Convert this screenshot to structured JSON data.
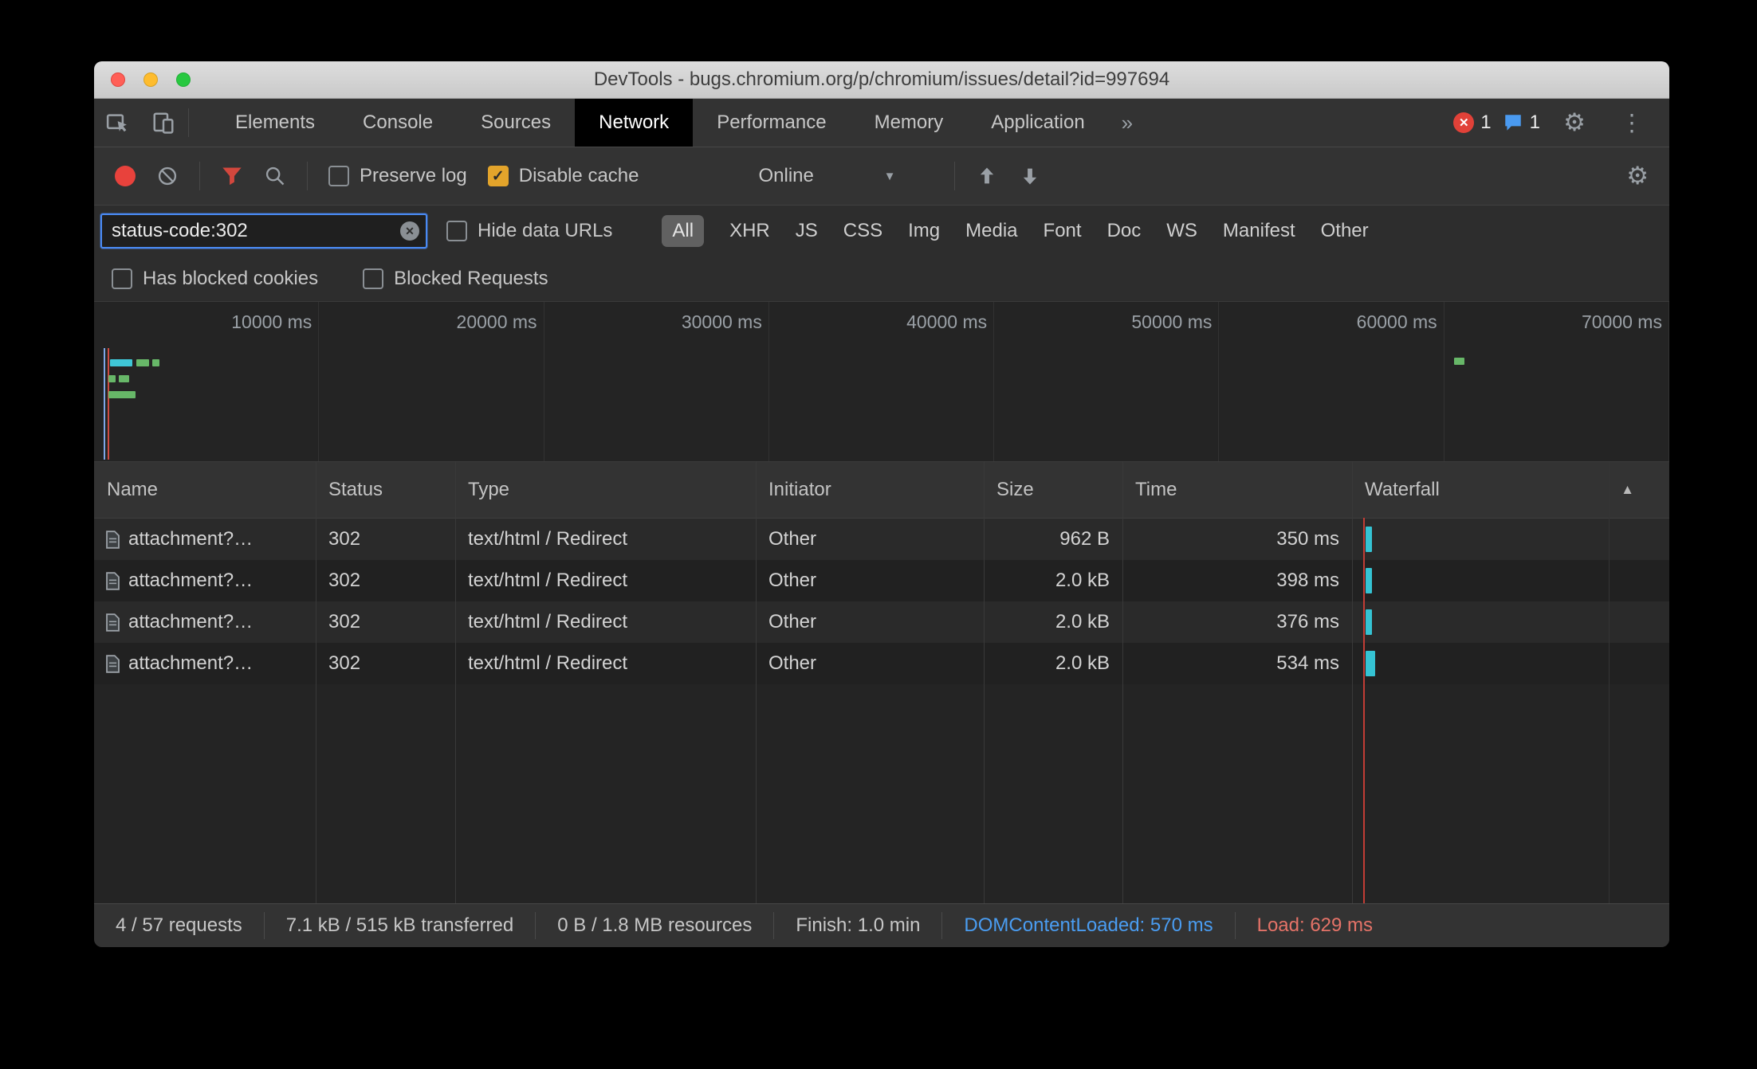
{
  "window": {
    "title": "DevTools - bugs.chromium.org/p/chromium/issues/detail?id=997694"
  },
  "main_tabs": {
    "items": [
      "Elements",
      "Console",
      "Sources",
      "Network",
      "Performance",
      "Memory",
      "Application"
    ],
    "selected": "Network"
  },
  "badges": {
    "error_count": "1",
    "message_count": "1"
  },
  "network_toolbar": {
    "preserve_log": "Preserve log",
    "disable_cache": "Disable cache",
    "disable_cache_checked": true,
    "preserve_log_checked": false,
    "throttling": "Online"
  },
  "filter_bar": {
    "filter_value": "status-code:302",
    "hide_data_urls": "Hide data URLs",
    "hide_data_urls_checked": false,
    "types": [
      "All",
      "XHR",
      "JS",
      "CSS",
      "Img",
      "Media",
      "Font",
      "Doc",
      "WS",
      "Manifest",
      "Other"
    ],
    "selected_type": "All"
  },
  "filter_row2": {
    "has_blocked_cookies": "Has blocked cookies",
    "blocked_requests": "Blocked Requests"
  },
  "timeline": {
    "labels": [
      "10000 ms",
      "20000 ms",
      "30000 ms",
      "40000 ms",
      "50000 ms",
      "60000 ms",
      "70000 ms"
    ]
  },
  "table": {
    "columns": [
      "Name",
      "Status",
      "Type",
      "Initiator",
      "Size",
      "Time",
      "Waterfall"
    ],
    "rows": [
      {
        "name": "attachment?…",
        "status": "302",
        "type": "text/html / Redirect",
        "initiator": "Other",
        "size": "962 B",
        "time": "350 ms"
      },
      {
        "name": "attachment?…",
        "status": "302",
        "type": "text/html / Redirect",
        "initiator": "Other",
        "size": "2.0 kB",
        "time": "398 ms"
      },
      {
        "name": "attachment?…",
        "status": "302",
        "type": "text/html / Redirect",
        "initiator": "Other",
        "size": "2.0 kB",
        "time": "376 ms"
      },
      {
        "name": "attachment?…",
        "status": "302",
        "type": "text/html / Redirect",
        "initiator": "Other",
        "size": "2.0 kB",
        "time": "534 ms"
      }
    ]
  },
  "footer": {
    "requests": "4 / 57 requests",
    "transferred": "7.1 kB / 515 kB transferred",
    "resources": "0 B / 1.8 MB resources",
    "finish": "Finish: 1.0 min",
    "dcl": "DOMContentLoaded: 570 ms",
    "load": "Load: 629 ms"
  },
  "icons": {
    "overflow_chevron": "»",
    "error_x": "✕",
    "clear_x": "✕",
    "gear": "⚙",
    "kebab": "⋮",
    "checkmark": "✓",
    "dropdown_arrow": "▼",
    "sort_asc": "▲"
  },
  "colors": {
    "accent_blue": "#4a8af4",
    "record_red": "#e8423c",
    "checkbox_orange": "#e3a42b",
    "waterfall_cyan": "#35c3d3",
    "overview_green": "#67b768",
    "load_line_red": "#c23d35",
    "dcl_text_blue": "#4a9df2",
    "load_text_red": "#e57368",
    "error_badge_red": "#e14138",
    "message_badge_blue": "#4a9af0"
  }
}
